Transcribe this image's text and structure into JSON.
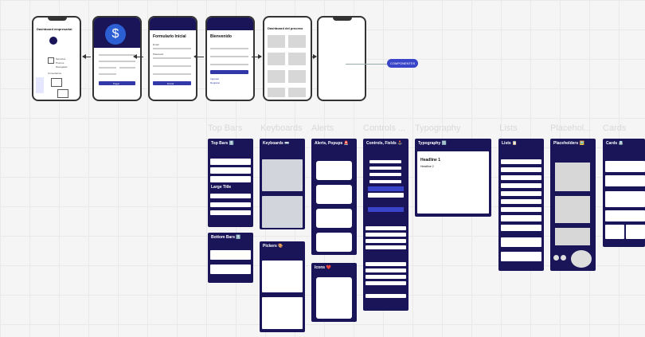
{
  "flow": {
    "screens": [
      {
        "title": "Dashboard empresarial",
        "texts": [
          "Servicios",
          "Promos",
          "Navegador",
          "Comentarios"
        ]
      },
      {
        "title": "",
        "texts": [
          "Pagar"
        ]
      },
      {
        "title": "Formulario Inicial",
        "texts": [
          "Email",
          "Password",
          "Enviar"
        ]
      },
      {
        "title": "Bienvenido",
        "texts": [
          "Ingresar",
          "Registrar"
        ]
      },
      {
        "title": "Dashboard del proceso",
        "texts": []
      },
      {
        "title": "",
        "texts": []
      }
    ],
    "component_label": "COMPONENTES"
  },
  "sections": [
    "Top Bars",
    "Keyboards",
    "Alerts",
    "Controls ...",
    "Typography",
    "Lists",
    "Placehol...",
    "Cards"
  ],
  "panels": {
    "top_bars": "Top Bars 🔝",
    "bottom_bars": "Bottom Bars 🔝",
    "keyboards": "Keyboards ⌨️",
    "pickers": "Pickers 🎨",
    "alerts": "Alerts, Popups 🚨",
    "icons": "Icons ❤️",
    "controls": "Controls, Fields 🕹️",
    "typography": "Typography 🔠",
    "lists": "Lists 📋",
    "placeholders": "Placeholders 🖼️",
    "cards": "Cards 📇"
  },
  "typography": {
    "headline1": "Headline 1",
    "headline2": "Headline 2"
  },
  "top_bars_extra": {
    "large_title": "Large Title"
  },
  "colors": {
    "accent": "#1a1558",
    "button": "#3338a8"
  }
}
